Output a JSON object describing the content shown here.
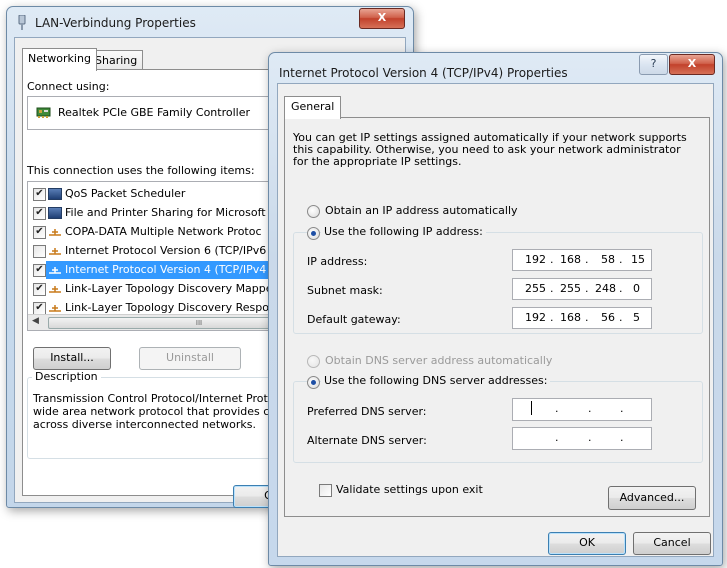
{
  "lan_window": {
    "title": "LAN-Verbindung Properties",
    "close_label": "X",
    "tabs": [
      {
        "label": "Networking",
        "active": true
      },
      {
        "label": "Sharing",
        "active": false
      }
    ],
    "connect_using_label": "Connect using:",
    "adapter_name": "Realtek PCIe GBE Family Controller",
    "items_label": "This connection uses the following items:",
    "items": [
      {
        "label": "QoS Packet Scheduler",
        "checked": true,
        "icon": "network-client-icon"
      },
      {
        "label": "File and Printer Sharing for Microsoft N",
        "checked": true,
        "icon": "network-client-icon"
      },
      {
        "label": "COPA-DATA Multiple Network Protoc",
        "checked": true,
        "icon": "protocol-icon"
      },
      {
        "label": "Internet Protocol Version 6 (TCP/IPv6",
        "checked": false,
        "icon": "protocol-icon"
      },
      {
        "label": "Internet Protocol Version 4 (TCP/IPv4",
        "checked": true,
        "icon": "protocol-icon",
        "selected": true
      },
      {
        "label": "Link-Layer Topology Discovery Mappe",
        "checked": true,
        "icon": "protocol-icon"
      },
      {
        "label": "Link-Layer Topology Discovery Respo",
        "checked": true,
        "icon": "protocol-icon"
      }
    ],
    "scroll_thumb_label": "III",
    "install_label": "Install...",
    "uninstall_label": "Uninstall",
    "description_label": "Description",
    "description_text": "Transmission Control Protocol/Internet Proto wide area network protocol that provides co across diverse interconnected networks.",
    "description_lines": [
      "Transmission Control Protocol/Internet Proto",
      "wide area network protocol that provides co",
      "across diverse interconnected networks."
    ],
    "ok_label": "OK"
  },
  "ipv4_window": {
    "title": "Internet Protocol Version 4 (TCP/IPv4) Properties",
    "help_label": "?",
    "close_label": "X",
    "tab_label": "General",
    "intro_lines": [
      "You can get IP settings assigned automatically if your network supports",
      "this capability. Otherwise, you need to ask your network administrator",
      "for the appropriate IP settings."
    ],
    "obtain_ip_auto_label": "Obtain an IP address automatically",
    "use_following_ip_label": "Use the following IP address:",
    "ip_address_label": "IP address:",
    "ip_address": [
      "192",
      "168",
      "58",
      "15"
    ],
    "subnet_mask_label": "Subnet mask:",
    "subnet_mask": [
      "255",
      "255",
      "248",
      "0"
    ],
    "default_gateway_label": "Default gateway:",
    "default_gateway": [
      "192",
      "168",
      "56",
      "5"
    ],
    "obtain_dns_auto_label": "Obtain DNS server address automatically",
    "use_following_dns_label": "Use the following DNS server addresses:",
    "preferred_dns_label": "Preferred DNS server:",
    "alternate_dns_label": "Alternate DNS server:",
    "dot": ".",
    "validate_label": "Validate settings upon exit",
    "advanced_label": "Advanced...",
    "ok_label": "OK",
    "cancel_label": "Cancel"
  }
}
